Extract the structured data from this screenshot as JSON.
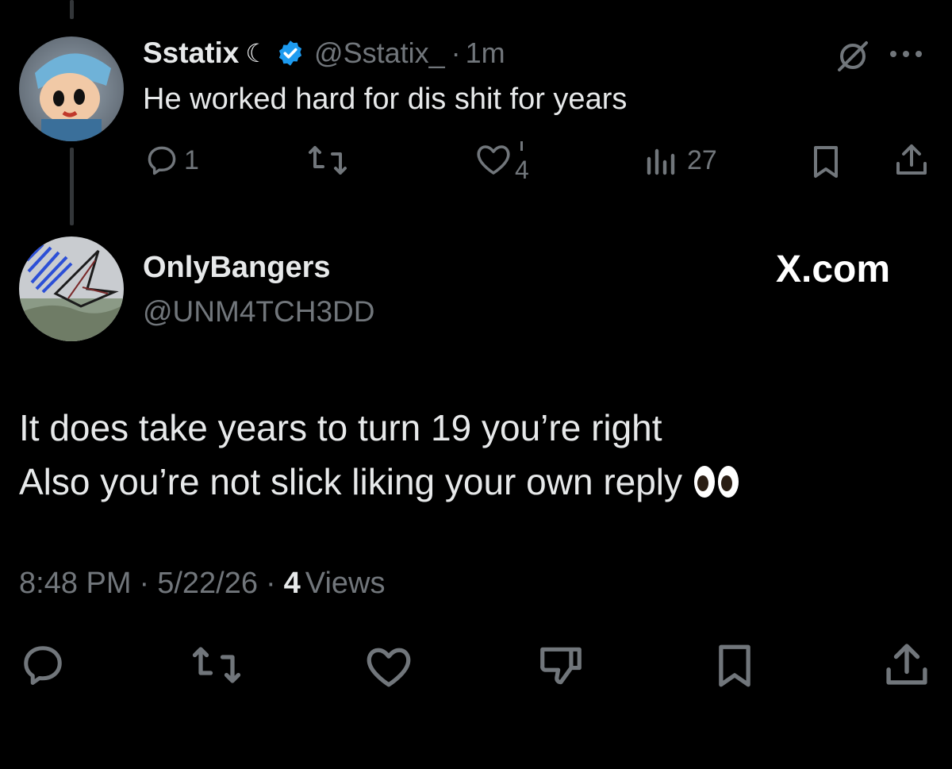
{
  "reply_tweet": {
    "author_name": "Sstatix",
    "name_suffix": "☾",
    "handle": "@Sstatix_",
    "separator": "·",
    "time": "1m",
    "text": "He worked hard for dis shit for years",
    "actions": {
      "reply_count": "1",
      "like_count": "4",
      "views_count": "27"
    }
  },
  "main_tweet": {
    "author_name": "OnlyBangers",
    "handle": "@UNM4TCH3DD",
    "brand": "X.com",
    "text_line1": "It does take years to turn 19 you’re right",
    "text_line2": "Also you’re not slick liking your own reply",
    "emoji": "👀",
    "meta": {
      "time": "8:48 PM",
      "sep1": "·",
      "date": "5/22/26",
      "sep2": "·",
      "views_count": "4",
      "views_label": "Views"
    }
  },
  "colors": {
    "background": "#000000",
    "text": "#e7e9ea",
    "muted": "#71767b",
    "verified": "#1d9bf0",
    "thread_line": "#333639"
  },
  "icons": [
    "reply-icon",
    "retweet-icon",
    "heart-icon",
    "views-icon",
    "bookmark-icon",
    "share-icon",
    "mute-icon",
    "more-icon",
    "verified-badge-icon",
    "downvote-icon"
  ]
}
